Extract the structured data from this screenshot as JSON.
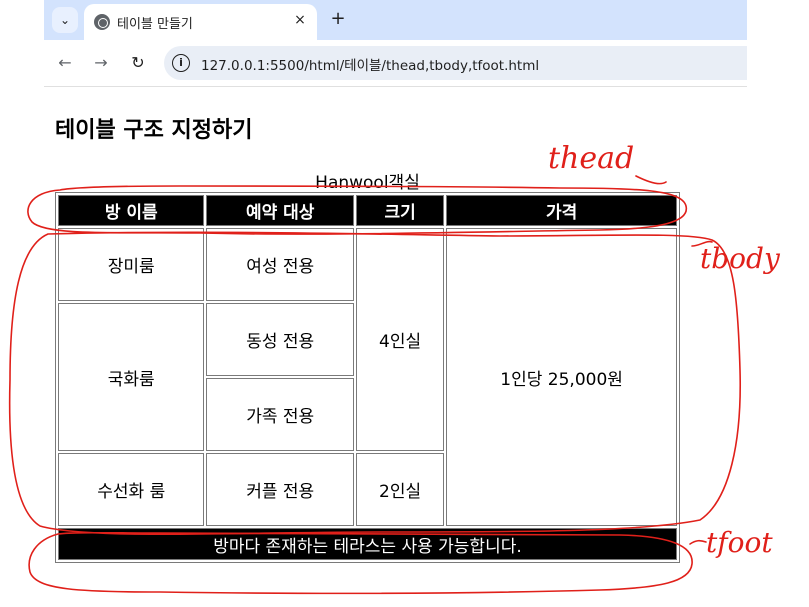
{
  "browser": {
    "tab_title": "테이블 만들기",
    "tab_close": "×",
    "new_tab": "+",
    "url": "127.0.0.1:5500/html/테이블/thead,tbody,tfoot.html",
    "icons": [
      "tab-search-icon",
      "globe-icon",
      "close-icon",
      "plus-icon",
      "back-arrow-icon",
      "forward-arrow-icon",
      "reload-icon",
      "site-info-icon"
    ]
  },
  "page": {
    "title": "테이블 구조 지정하기",
    "table": {
      "caption": "Hanwool객실",
      "headers": [
        "방 이름",
        "예약 대상",
        "크기",
        "가격"
      ],
      "rows": {
        "r1": {
          "room": "장미룸",
          "target": "여성 전용"
        },
        "r2": {
          "room": "국화룸",
          "target": "동성 전용"
        },
        "r3": {
          "target": "가족 전용"
        },
        "r4": {
          "room": "수선화 룸",
          "target": "커플 전용",
          "size": "2인실"
        },
        "size_shared": "4인실",
        "price_shared": "1인당 25,000원"
      },
      "footer": "방마다 존재하는 테라스는 사용 가능합니다."
    }
  },
  "annotations": {
    "thead_label": "thead",
    "tbody_label": "tbody",
    "tfoot_label": "tfoot",
    "color": "#e0201a"
  }
}
